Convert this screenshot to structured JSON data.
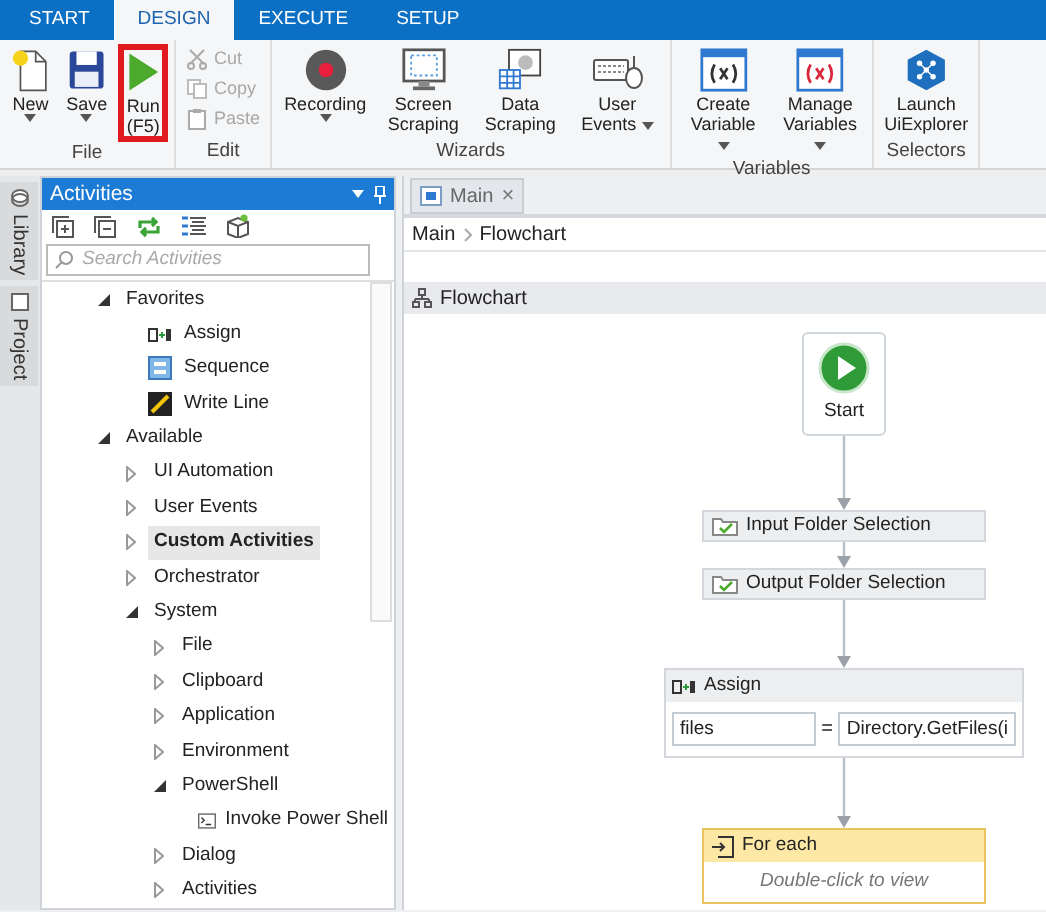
{
  "ribbon": {
    "tabs": [
      {
        "label": "START",
        "selected": false
      },
      {
        "label": "DESIGN",
        "selected": true
      },
      {
        "label": "EXECUTE",
        "selected": false
      },
      {
        "label": "SETUP",
        "selected": false
      }
    ],
    "groups": [
      {
        "label": "File",
        "buttons": [
          {
            "kind": "new",
            "label": "New",
            "dropdown": true,
            "highlighted": false
          },
          {
            "kind": "save",
            "label": "Save",
            "dropdown": true,
            "highlighted": false
          },
          {
            "kind": "run",
            "label": "Run",
            "shortcut": "(F5)",
            "dropdown": false,
            "highlighted": true
          }
        ]
      },
      {
        "label": "Edit",
        "small_buttons": [
          {
            "kind": "cut",
            "label": "Cut",
            "disabled": true
          },
          {
            "kind": "copy",
            "label": "Copy",
            "disabled": true
          },
          {
            "kind": "paste",
            "label": "Paste",
            "disabled": true
          }
        ]
      },
      {
        "label": "Wizards",
        "buttons": [
          {
            "kind": "recording",
            "label": "Recording",
            "dropdown": true,
            "highlighted": false
          },
          {
            "kind": "screen",
            "label": "Screen Scraping",
            "dropdown": false,
            "highlighted": false
          },
          {
            "kind": "data",
            "label": "Data Scraping",
            "dropdown": false,
            "highlighted": false
          },
          {
            "kind": "events",
            "label": "User Events",
            "dropdown": true,
            "highlighted": false
          }
        ]
      },
      {
        "label": "Variables",
        "buttons": [
          {
            "kind": "createvar",
            "label": "Create Variable",
            "dropdown": true,
            "highlighted": false
          },
          {
            "kind": "managevar",
            "label": "Manage Variables",
            "dropdown": true,
            "highlighted": false
          }
        ]
      },
      {
        "label": "Selectors",
        "buttons": [
          {
            "kind": "explorer",
            "label": "Launch UiExplorer",
            "dropdown": false,
            "highlighted": false
          }
        ]
      }
    ]
  },
  "side_tabs": [
    {
      "kind": "library",
      "label": "Library"
    },
    {
      "kind": "project",
      "label": "Project"
    }
  ],
  "activities": {
    "title": "Activities",
    "search": {
      "placeholder": "Search Activities"
    },
    "tree": [
      {
        "kind": "category",
        "label": "Favorites",
        "expanded": true,
        "selected": false,
        "children": [
          {
            "kind": "assign",
            "label": "Assign",
            "selected": false
          },
          {
            "kind": "sequence",
            "label": "Sequence",
            "selected": false
          },
          {
            "kind": "writeline",
            "label": "Write Line",
            "selected": false
          }
        ]
      },
      {
        "kind": "category",
        "label": "Available",
        "expanded": true,
        "selected": false,
        "children": [
          {
            "kind": "category",
            "label": "UI Automation",
            "expanded": false,
            "selected": false
          },
          {
            "kind": "category",
            "label": "User Events",
            "expanded": false,
            "selected": false
          },
          {
            "kind": "category",
            "label": "Custom Activities",
            "expanded": false,
            "selected": true
          },
          {
            "kind": "category",
            "label": "Orchestrator",
            "expanded": false,
            "selected": false
          },
          {
            "kind": "category",
            "label": "System",
            "expanded": true,
            "selected": false,
            "children": [
              {
                "kind": "category",
                "label": "File",
                "expanded": false,
                "selected": false
              },
              {
                "kind": "category",
                "label": "Clipboard",
                "expanded": false,
                "selected": false
              },
              {
                "kind": "category",
                "label": "Application",
                "expanded": false,
                "selected": false
              },
              {
                "kind": "category",
                "label": "Environment",
                "expanded": false,
                "selected": false
              },
              {
                "kind": "category",
                "label": "PowerShell",
                "expanded": true,
                "selected": false,
                "children": [
                  {
                    "kind": "script",
                    "label": "Invoke Power Shell",
                    "selected": false
                  }
                ]
              },
              {
                "kind": "category",
                "label": "Dialog",
                "expanded": false,
                "selected": false
              },
              {
                "kind": "category",
                "label": "Activities",
                "expanded": false,
                "selected": false
              }
            ]
          }
        ]
      }
    ]
  },
  "designer": {
    "tab": {
      "label": "Main",
      "close": "×"
    },
    "breadcrumb": [
      "Main",
      "Flowchart"
    ],
    "header": "Flowchart",
    "nodes": [
      {
        "kind": "start",
        "label": "Start"
      },
      {
        "kind": "sequence",
        "label": "Input Folder Selection"
      },
      {
        "kind": "sequence",
        "label": "Output Folder Selection"
      },
      {
        "kind": "assign",
        "label": "Assign",
        "to": "files",
        "operator": "=",
        "value": "Directory.GetFiles(i"
      },
      {
        "kind": "foreach",
        "label": "For each",
        "hint": "Double-click to view"
      }
    ]
  }
}
